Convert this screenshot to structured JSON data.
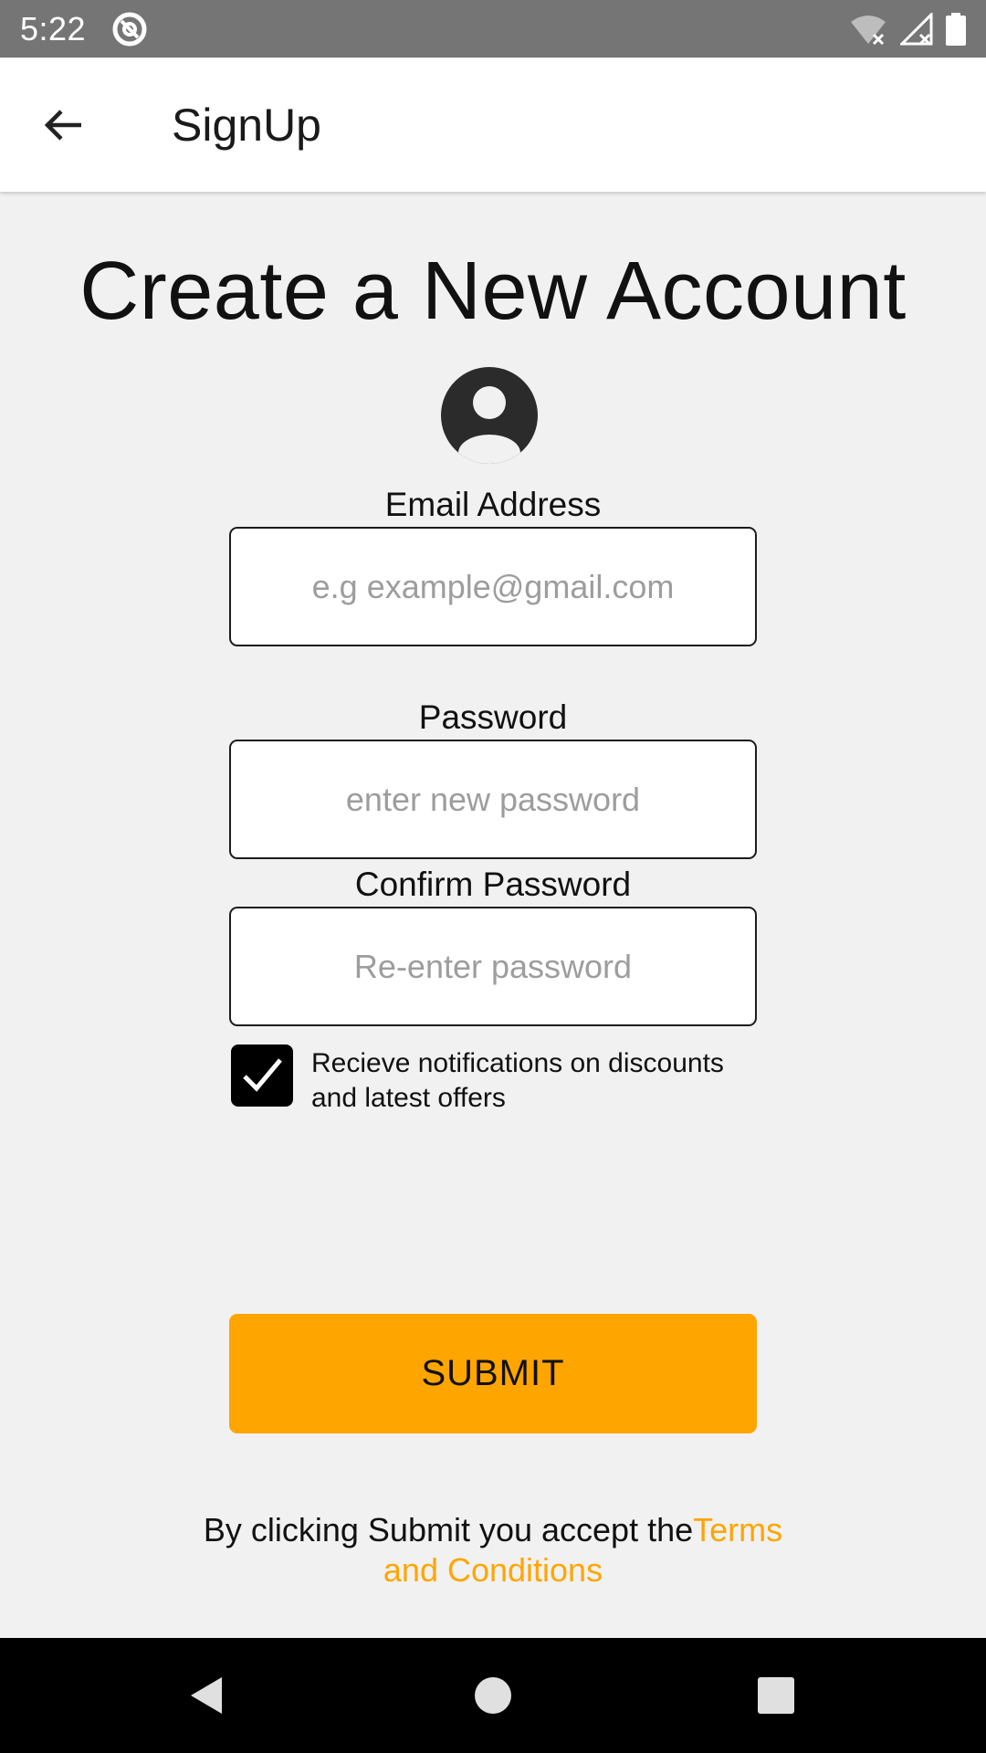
{
  "status_bar": {
    "time": "5:22"
  },
  "app_bar": {
    "title": "SignUp"
  },
  "main": {
    "heading": "Create a New Account",
    "email": {
      "label": "Email Address",
      "placeholder": "e.g example@gmail.com",
      "value": ""
    },
    "password": {
      "label": "Password",
      "placeholder": "enter new password",
      "value": ""
    },
    "confirm_password": {
      "label": "Confirm Password",
      "placeholder": "Re-enter password",
      "value": ""
    },
    "notifications_checkbox": {
      "checked": true,
      "label": "Recieve notifications on discounts and latest offers"
    },
    "submit_label": "SUBMIT",
    "terms": {
      "prefix": "By clicking Submit you accept the",
      "link": "Terms and Conditions"
    }
  },
  "colors": {
    "accent": "#ffa500",
    "status_bar": "#757575",
    "background": "#f1f1f1",
    "nav_bar": "#000000"
  },
  "icons": {
    "back": "arrow-left-icon",
    "avatar": "account-circle-icon",
    "checkbox": "check-icon",
    "status": [
      "app-notification-icon",
      "wifi-off-icon",
      "signal-off-icon",
      "battery-icon"
    ],
    "nav": [
      "back-triangle-icon",
      "home-circle-icon",
      "recents-square-icon"
    ]
  }
}
